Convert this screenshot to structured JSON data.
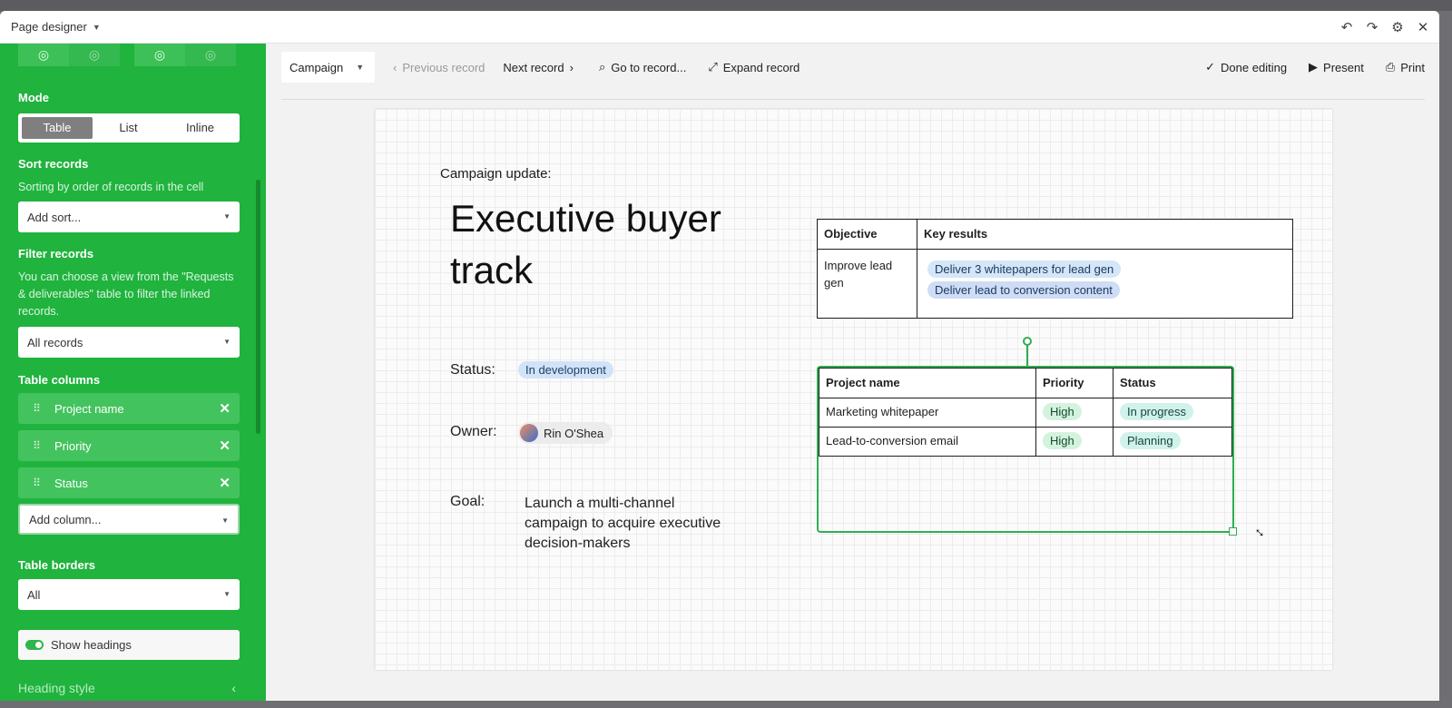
{
  "window": {
    "title": "Page designer"
  },
  "sidebar": {
    "mode_label": "Mode",
    "mode_options": [
      "Table",
      "List",
      "Inline"
    ],
    "sort_label": "Sort records",
    "sort_help": "Sorting by order of records in the cell",
    "sort_select": "Add sort...",
    "filter_label": "Filter records",
    "filter_help": "You can choose a view from the \"Requests & deliverables\" table to filter the linked records.",
    "filter_select": "All records",
    "columns_label": "Table columns",
    "columns": [
      "Project name",
      "Priority",
      "Status"
    ],
    "add_column": "Add column...",
    "borders_label": "Table borders",
    "borders_select": "All",
    "show_headings": "Show headings",
    "heading_style": "Heading style"
  },
  "toolbar": {
    "table_select": "Campaign",
    "previous_record": "Previous record",
    "next_record": "Next record",
    "go_to_record": "Go to record...",
    "expand_record": "Expand record",
    "done_editing": "Done editing",
    "present": "Present",
    "print": "Print"
  },
  "page": {
    "campaign_label": "Campaign update:",
    "title": "Executive buyer track",
    "status_label": "Status:",
    "status_value": "In development",
    "owner_label": "Owner:",
    "owner_name": "Rin O'Shea",
    "goal_label": "Goal:",
    "goal_text": "Launch a multi-channel campaign to acquire executive decision-makers",
    "okr_table": {
      "headers": [
        "Objective",
        "Key results"
      ],
      "objective": "Improve lead gen",
      "key_results": [
        "Deliver 3 whitepapers for lead gen",
        "Deliver lead to conversion content"
      ]
    },
    "projects_table": {
      "headers": [
        "Project name",
        "Priority",
        "Status"
      ],
      "rows": [
        {
          "name": "Marketing whitepaper",
          "priority": "High",
          "status": "In progress"
        },
        {
          "name": "Lead-to-conversion email",
          "priority": "High",
          "status": "Planning"
        }
      ]
    }
  },
  "colors": {
    "sidebar": "#20b33e",
    "selection": "#2fae52"
  }
}
